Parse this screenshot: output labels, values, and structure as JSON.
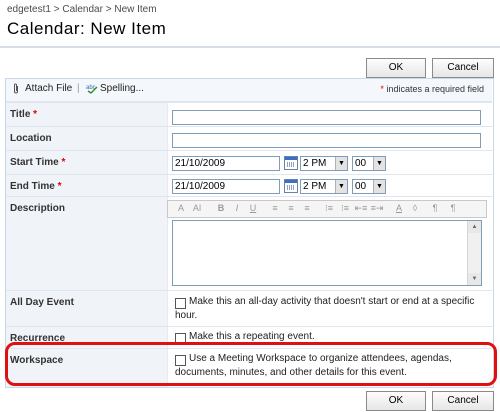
{
  "breadcrumb": {
    "site": "edgetest1",
    "sep1": ">",
    "list": "Calendar",
    "sep2": ">",
    "current": "New Item"
  },
  "page_title": "Calendar: New Item",
  "buttons": {
    "ok": "OK",
    "cancel": "Cancel"
  },
  "toolbar": {
    "attach": "Attach File",
    "divider": "|",
    "spelling": "Spelling...",
    "required_star": "*",
    "required_note": "indicates a required field"
  },
  "fields": {
    "title": {
      "label": "Title",
      "star": "*",
      "value": ""
    },
    "location": {
      "label": "Location",
      "value": ""
    },
    "start_time": {
      "label": "Start Time",
      "star": "*",
      "date": "21/10/2009",
      "hour": "2 PM",
      "minute": "00"
    },
    "end_time": {
      "label": "End Time",
      "star": "*",
      "date": "21/10/2009",
      "hour": "2 PM",
      "minute": "00"
    },
    "description": {
      "label": "Description",
      "rte_buttons": [
        "A",
        "Aǀ",
        "B",
        "I",
        "U",
        "≡",
        "≡",
        "≡",
        "⁝≡",
        "⁝≡",
        "⇤≡",
        "≡⇥",
        "A",
        "◊",
        "¶",
        "¶"
      ]
    },
    "all_day": {
      "label": "All Day Event",
      "checked": false,
      "text_line1": "Make this an all-day activity that doesn't start or end at a specific",
      "text_line2": "hour."
    },
    "recurrence": {
      "label": "Recurrence",
      "checked": false,
      "text": "Make this a repeating event."
    },
    "workspace": {
      "label": "Workspace",
      "checked": false,
      "text_line1": "Use a Meeting Workspace to organize attendees, agendas,",
      "text_line2": "documents, minutes, and other details for this event."
    }
  },
  "colors": {
    "required": "#dd0000",
    "highlight": "#e01010",
    "label_bg": "#f0f3f8"
  }
}
